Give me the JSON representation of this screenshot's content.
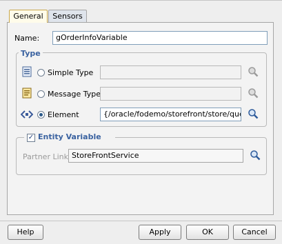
{
  "tabs": [
    {
      "label": "General",
      "active": true
    },
    {
      "label": "Sensors",
      "active": false
    }
  ],
  "name": {
    "label": "Name:",
    "value": "gOrderInfoVariable"
  },
  "type_group": {
    "title": "Type",
    "options": [
      {
        "label": "Simple Type",
        "selected": false,
        "value": "",
        "icon": "simple-type-icon"
      },
      {
        "label": "Message Type",
        "selected": false,
        "value": "",
        "icon": "message-type-icon"
      },
      {
        "label": "Element",
        "selected": true,
        "value": "{/oracle/fodemo/storefront/store/queries",
        "icon": "element-icon"
      }
    ],
    "browse_icon": "search-icon"
  },
  "entity_group": {
    "title": "Entity Variable",
    "checked": true,
    "partner_link_label": "Partner Link:",
    "partner_link_value": "StoreFrontService"
  },
  "buttons": {
    "help": "Help",
    "apply": "Apply",
    "ok": "OK",
    "cancel": "Cancel"
  },
  "colors": {
    "accent": "#3a62a0",
    "active_tab": "#fffcea"
  }
}
